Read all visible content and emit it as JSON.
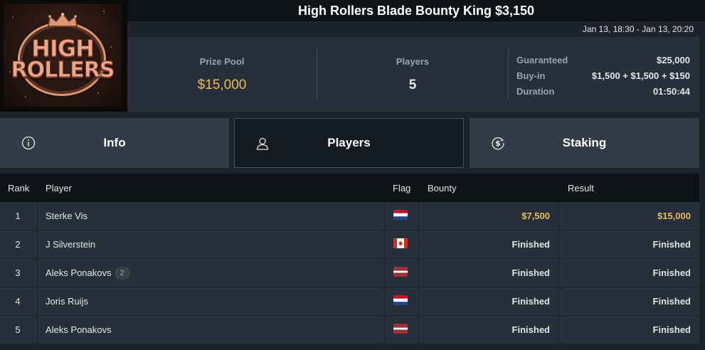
{
  "header": {
    "title": "High Rollers Blade Bounty King $3,150",
    "date_range": "Jan 13, 18:30 - Jan 13, 20:20"
  },
  "logo": {
    "line1": "HIGH",
    "line2": "ROLLERS",
    "icon": "crown-icon"
  },
  "summary": {
    "prize_pool_label": "Prize Pool",
    "prize_pool_value": "$15,000",
    "players_label": "Players",
    "players_value": "5",
    "details": [
      {
        "label": "Guaranteed",
        "value": "$25,000"
      },
      {
        "label": "Buy-in",
        "value": "$1,500 + $1,500 + $150"
      },
      {
        "label": "Duration",
        "value": "01:50:44"
      }
    ]
  },
  "tabs": [
    {
      "label": "Info",
      "icon": "info-circle-icon"
    },
    {
      "label": "Players",
      "icon": "user-icon",
      "active": true
    },
    {
      "label": "Staking",
      "icon": "dollar-coin-icon"
    }
  ],
  "table": {
    "headers": {
      "rank": "Rank",
      "player": "Player",
      "flag": "Flag",
      "bounty": "Bounty",
      "result": "Result"
    },
    "rows": [
      {
        "rank": "1",
        "player": "Sterke Vis",
        "badge": "",
        "flag": "netherlands-flag-icon",
        "bounty": "$7,500",
        "result": "$15,000"
      },
      {
        "rank": "2",
        "player": "J Silverstein",
        "badge": "",
        "flag": "canada-flag-icon",
        "bounty": "Finished",
        "result": "Finished"
      },
      {
        "rank": "3",
        "player": "Aleks Ponakovs",
        "badge": "2",
        "flag": "latvia-flag-icon",
        "bounty": "Finished",
        "result": "Finished"
      },
      {
        "rank": "4",
        "player": "Joris Ruijs",
        "badge": "",
        "flag": "netherlands-flag-icon",
        "bounty": "Finished",
        "result": "Finished"
      },
      {
        "rank": "5",
        "player": "Aleks Ponakovs",
        "badge": "",
        "flag": "latvia-flag-icon",
        "bounty": "Finished",
        "result": "Finished"
      }
    ]
  },
  "colors": {
    "accent_gold": "#e9b95a",
    "background": "#1c232b",
    "panel": "#27303a",
    "tab": "#333c46",
    "tab_active": "#131a20"
  }
}
